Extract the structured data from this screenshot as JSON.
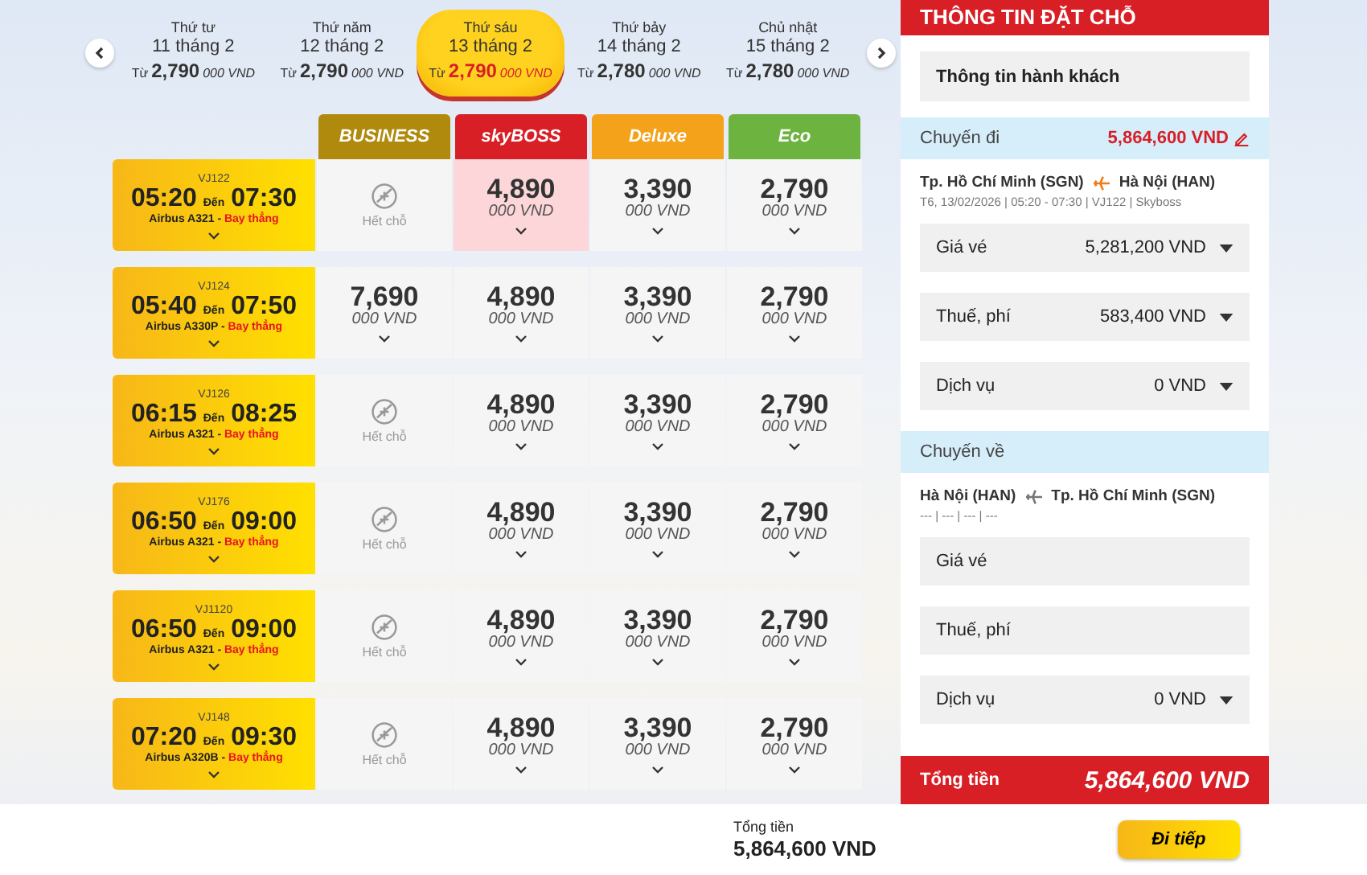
{
  "dates": [
    {
      "weekday": "Thứ tư",
      "date": "11 tháng 2",
      "from": "Từ",
      "price": "2,790",
      "unit": "000 VND",
      "selected": false
    },
    {
      "weekday": "Thứ năm",
      "date": "12 tháng 2",
      "from": "Từ",
      "price": "2,790",
      "unit": "000 VND",
      "selected": false
    },
    {
      "weekday": "Thứ sáu",
      "date": "13 tháng 2",
      "from": "Từ",
      "price": "2,790",
      "unit": "000 VND",
      "selected": true
    },
    {
      "weekday": "Thứ bảy",
      "date": "14 tháng 2",
      "from": "Từ",
      "price": "2,780",
      "unit": "000 VND",
      "selected": false
    },
    {
      "weekday": "Chủ nhật",
      "date": "15 tháng 2",
      "from": "Từ",
      "price": "2,780",
      "unit": "000 VND",
      "selected": false
    }
  ],
  "fare_classes": [
    {
      "label": "BUSINESS",
      "color": "#b08a0c"
    },
    {
      "label": "skyBOSS",
      "color": "#d81f26"
    },
    {
      "label": "Deluxe",
      "color": "#f5a21b"
    },
    {
      "label": "Eco",
      "color": "#6cb33f"
    }
  ],
  "flights": [
    {
      "code": "VJ122",
      "depart": "05:20",
      "to": "Đến",
      "arrive": "07:30",
      "aircraft": "Airbus A321 -",
      "type": "Bay thẳng",
      "fares": [
        {
          "kind": "soldout",
          "label": "Hết chỗ"
        },
        {
          "kind": "price",
          "price": "4,890",
          "unit": "000 VND",
          "selected": true
        },
        {
          "kind": "price",
          "price": "3,390",
          "unit": "000 VND",
          "selected": false
        },
        {
          "kind": "price",
          "price": "2,790",
          "unit": "000 VND",
          "selected": false
        }
      ]
    },
    {
      "code": "VJ124",
      "depart": "05:40",
      "to": "Đến",
      "arrive": "07:50",
      "aircraft": "Airbus A330P -",
      "type": "Bay thẳng",
      "fares": [
        {
          "kind": "price",
          "price": "7,690",
          "unit": "000 VND",
          "selected": false
        },
        {
          "kind": "price",
          "price": "4,890",
          "unit": "000 VND",
          "selected": false
        },
        {
          "kind": "price",
          "price": "3,390",
          "unit": "000 VND",
          "selected": false
        },
        {
          "kind": "price",
          "price": "2,790",
          "unit": "000 VND",
          "selected": false
        }
      ]
    },
    {
      "code": "VJ126",
      "depart": "06:15",
      "to": "Đến",
      "arrive": "08:25",
      "aircraft": "Airbus A321 -",
      "type": "Bay thẳng",
      "fares": [
        {
          "kind": "soldout",
          "label": "Hết chỗ"
        },
        {
          "kind": "price",
          "price": "4,890",
          "unit": "000 VND",
          "selected": false
        },
        {
          "kind": "price",
          "price": "3,390",
          "unit": "000 VND",
          "selected": false
        },
        {
          "kind": "price",
          "price": "2,790",
          "unit": "000 VND",
          "selected": false
        }
      ]
    },
    {
      "code": "VJ176",
      "depart": "06:50",
      "to": "Đến",
      "arrive": "09:00",
      "aircraft": "Airbus A321 -",
      "type": "Bay thẳng",
      "fares": [
        {
          "kind": "soldout",
          "label": "Hết chỗ"
        },
        {
          "kind": "price",
          "price": "4,890",
          "unit": "000 VND",
          "selected": false
        },
        {
          "kind": "price",
          "price": "3,390",
          "unit": "000 VND",
          "selected": false
        },
        {
          "kind": "price",
          "price": "2,790",
          "unit": "000 VND",
          "selected": false
        }
      ]
    },
    {
      "code": "VJ1120",
      "depart": "06:50",
      "to": "Đến",
      "arrive": "09:00",
      "aircraft": "Airbus A321 -",
      "type": "Bay thẳng",
      "fares": [
        {
          "kind": "soldout",
          "label": "Hết chỗ"
        },
        {
          "kind": "price",
          "price": "4,890",
          "unit": "000 VND",
          "selected": false
        },
        {
          "kind": "price",
          "price": "3,390",
          "unit": "000 VND",
          "selected": false
        },
        {
          "kind": "price",
          "price": "2,790",
          "unit": "000 VND",
          "selected": false
        }
      ]
    },
    {
      "code": "VJ148",
      "depart": "07:20",
      "to": "Đến",
      "arrive": "09:30",
      "aircraft": "Airbus A320B -",
      "type": "Bay thẳng",
      "fares": [
        {
          "kind": "soldout",
          "label": "Hết chỗ"
        },
        {
          "kind": "price",
          "price": "4,890",
          "unit": "000 VND",
          "selected": false
        },
        {
          "kind": "price",
          "price": "3,390",
          "unit": "000 VND",
          "selected": false
        },
        {
          "kind": "price",
          "price": "2,790",
          "unit": "000 VND",
          "selected": false
        }
      ]
    }
  ],
  "booking": {
    "title": "THÔNG TIN ĐẶT CHỖ",
    "passenger_button": "Thông tin hành khách",
    "legs": [
      {
        "kind": "outbound",
        "title": "Chuyến đi",
        "amount": "5,864,600 VND",
        "origin": "Tp. Hồ Chí Minh (SGN)",
        "destination": "Hà Nội (HAN)",
        "details": "T6, 13/02/2026 | 05:20 - 07:30 | VJ122 | Skyboss",
        "items": [
          {
            "label": "Giá vé",
            "value": "5,281,200 VND"
          },
          {
            "label": "Thuế, phí",
            "value": "583,400 VND"
          },
          {
            "label": "Dịch vụ",
            "value": "0 VND"
          }
        ]
      },
      {
        "kind": "return",
        "title": "Chuyến về",
        "origin": "Hà Nội (HAN)",
        "destination": "Tp. Hồ Chí Minh (SGN)",
        "details": "--- | --- | --- | ---",
        "items": [
          {
            "label": "Giá vé"
          },
          {
            "label": "Thuế, phí"
          },
          {
            "label": "Dịch vụ",
            "value": "0 VND"
          }
        ]
      }
    ],
    "total_label": "Tổng tiền",
    "total": "5,864,600 VND"
  },
  "footer": {
    "total_label": "Tổng tiền",
    "total": "5,864,600 VND",
    "continue_button": "Đi tiếp"
  }
}
